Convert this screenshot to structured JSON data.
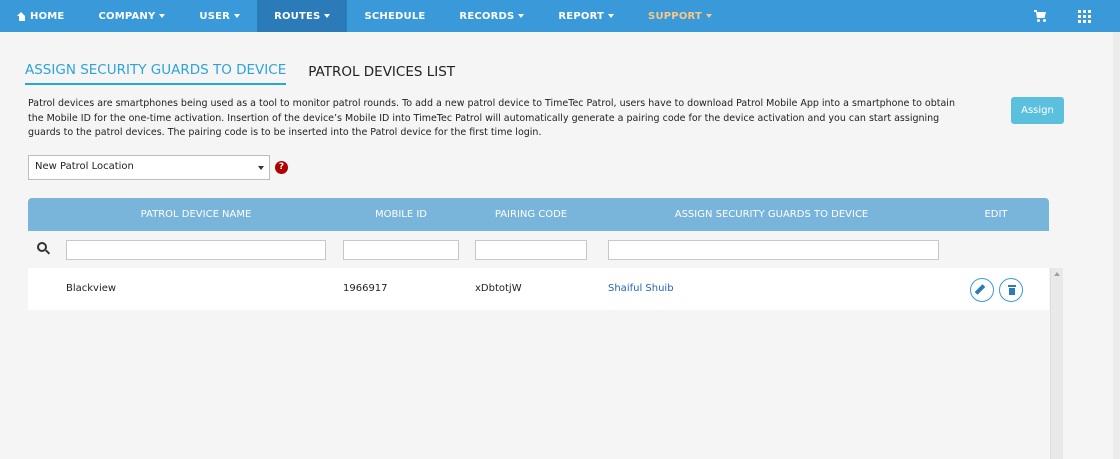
{
  "nav": {
    "items": [
      {
        "label": "HOME",
        "icon": "home-icon"
      },
      {
        "label": "COMPANY",
        "caret": true
      },
      {
        "label": "USER",
        "caret": true
      },
      {
        "label": "ROUTES",
        "caret": true,
        "active": true
      },
      {
        "label": "SCHEDULE"
      },
      {
        "label": "RECORDS",
        "caret": true
      },
      {
        "label": "REPORT",
        "caret": true
      },
      {
        "label": "SUPPORT",
        "caret": true
      }
    ],
    "colors": {
      "bar": "#3a9ad9",
      "active": "#2a7bb8",
      "support": "#f7c78a"
    }
  },
  "tabs": [
    {
      "label": "ASSIGN SECURITY GUARDS TO DEVICE",
      "active": true
    },
    {
      "label": "PATROL DEVICES LIST",
      "active": false
    }
  ],
  "description": "Patrol devices are smartphones being used as a tool to monitor patrol rounds. To add a new patrol device to TimeTec Patrol, users have to download Patrol Mobile App into a smartphone to obtain the Mobile ID for the one-time activation. Insertion of the device’s Mobile ID into TimeTec Patrol will automatically generate a pairing code for the device activation and you can start assigning guards to the patrol devices. The pairing code is to be inserted into the Patrol device for the first time login.",
  "assign_button": "Assign",
  "location_select": {
    "value": "New Patrol Location"
  },
  "help_icon": "?",
  "table": {
    "headers": [
      "PATROL DEVICE NAME",
      "MOBILE ID",
      "PAIRING CODE",
      "ASSIGN SECURITY GUARDS TO DEVICE",
      "EDIT"
    ],
    "filters": [
      "",
      "",
      "",
      ""
    ],
    "rows": [
      {
        "device_name": "Blackview",
        "mobile_id": "1966917",
        "pairing_code": "xDbtotjW",
        "guards": "Shaiful Shuib"
      }
    ]
  }
}
